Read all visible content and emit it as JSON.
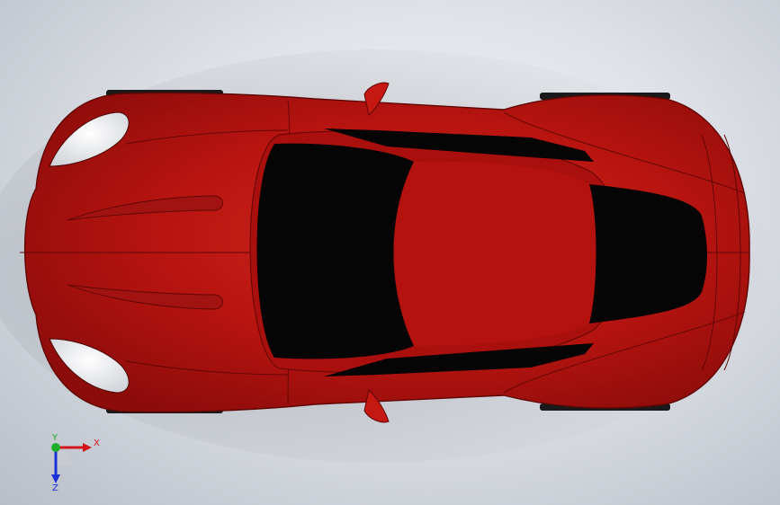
{
  "viewport": {
    "view": "top",
    "model": "sports-car",
    "colors": {
      "background_light": "#f4f5f8",
      "background_dark": "#b9bec7",
      "body": "#b81410",
      "body_highlight": "#d42a1f",
      "body_shadow": "#7e0a08",
      "glass": "#050505",
      "headlight": "#e4e6ea",
      "tire": "#1a1a1a"
    }
  },
  "triad": {
    "x_label": "X",
    "y_label": "Y",
    "z_label": "Z",
    "colors": {
      "x": "#d0161b",
      "y": "#1fae2b",
      "z": "#1b2fd6"
    }
  }
}
